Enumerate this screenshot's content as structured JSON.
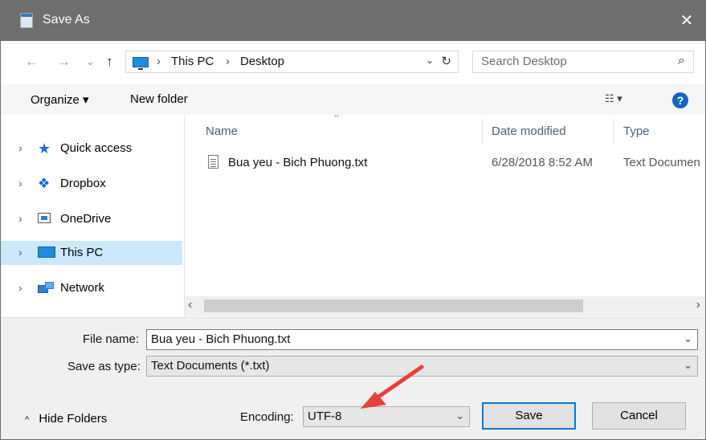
{
  "titlebar": {
    "title": "Save As",
    "close_glyph": "✕",
    "icon": "notepad-icon"
  },
  "nav": {
    "back": "←",
    "forward": "→",
    "recent": "⌄",
    "up": "↑"
  },
  "address": {
    "sep1": "›",
    "crumb1": "This PC",
    "sep2": "›",
    "crumb2": "Desktop",
    "dropdown": "⌄",
    "refresh": "↻"
  },
  "search": {
    "placeholder": "Search Desktop",
    "icon": "⌕"
  },
  "toolbar": {
    "organize": "Organize ▾",
    "new_folder": "New folder",
    "view": "☷ ▾",
    "help": "?"
  },
  "navpane": {
    "items": [
      {
        "label": "Quick access",
        "icon": "star-icon"
      },
      {
        "label": "Dropbox",
        "icon": "dropbox-icon"
      },
      {
        "label": "OneDrive",
        "icon": "onedrive-icon"
      },
      {
        "label": "This PC",
        "icon": "computer-icon",
        "selected": true
      },
      {
        "label": "Network",
        "icon": "network-icon"
      }
    ],
    "chevron": "›"
  },
  "filelist": {
    "columns": {
      "name": "Name",
      "date": "Date modified",
      "type": "Type"
    },
    "sort_caret": "^",
    "rows": [
      {
        "name": "Bua yeu - Bich Phuong.txt",
        "date": "6/28/2018 8:52 AM",
        "type": "Text Documen"
      }
    ]
  },
  "hscroll": {
    "left": "‹",
    "right": "›"
  },
  "form": {
    "file_name_label": "File name:",
    "file_name_value": "Bua yeu - Bich Phuong.txt",
    "save_type_label": "Save as type:",
    "save_type_value": "Text Documents (*.txt)",
    "encoding_label": "Encoding:",
    "encoding_value": "UTF-8",
    "combo_arrow": "⌄"
  },
  "buttons": {
    "hide_folders": "Hide Folders",
    "hide_caret": "^",
    "save": "Save",
    "cancel": "Cancel"
  },
  "colors": {
    "annotation_arrow": "#e8413b",
    "selection": "#cce8ff",
    "titlebar": "#6e6e6e",
    "accent": "#0078d7"
  }
}
